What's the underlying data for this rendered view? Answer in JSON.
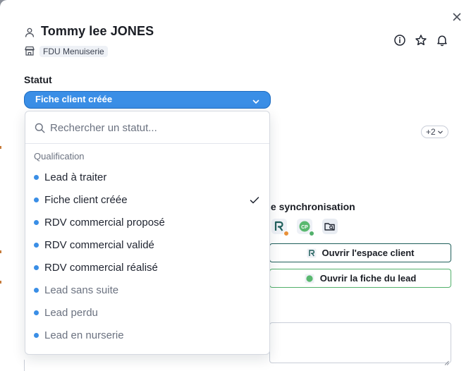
{
  "header": {
    "title": "Tommy lee JONES",
    "company": "FDU Menuiserie"
  },
  "icons": {
    "user": "user-icon",
    "company": "store-icon",
    "info": "info-icon",
    "favorite": "star-icon",
    "notifications": "bell-icon",
    "close": "close-icon"
  },
  "statut": {
    "label": "Statut",
    "selected": "Fiche client créée"
  },
  "dropdown": {
    "search_placeholder": "Rechercher un statut...",
    "group_label": "Qualification",
    "options": [
      {
        "label": "Lead à traiter",
        "selected": false,
        "muted": false
      },
      {
        "label": "Fiche client créée",
        "selected": true,
        "muted": false
      },
      {
        "label": "RDV commercial proposé",
        "selected": false,
        "muted": false
      },
      {
        "label": "RDV commercial validé",
        "selected": false,
        "muted": false
      },
      {
        "label": "RDV commercial réalisé",
        "selected": false,
        "muted": false
      },
      {
        "label": "Lead sans suite",
        "selected": false,
        "muted": true
      },
      {
        "label": "Lead perdu",
        "selected": false,
        "muted": true
      },
      {
        "label": "Lead en nurserie",
        "selected": false,
        "muted": true
      }
    ]
  },
  "background": {
    "tags_more": "+2",
    "sync_heading": "le synchronisation",
    "open_client_space": "Ouvrir l'espace client",
    "open_lead_sheet": "Ouvrir la fiche du lead"
  },
  "colors": {
    "accent": "#3a8ee6",
    "accent_border": "#1e6cc0",
    "bullet": "#3a8ee6",
    "teal_border": "#1f5f5b",
    "green_border": "#52b06b"
  }
}
